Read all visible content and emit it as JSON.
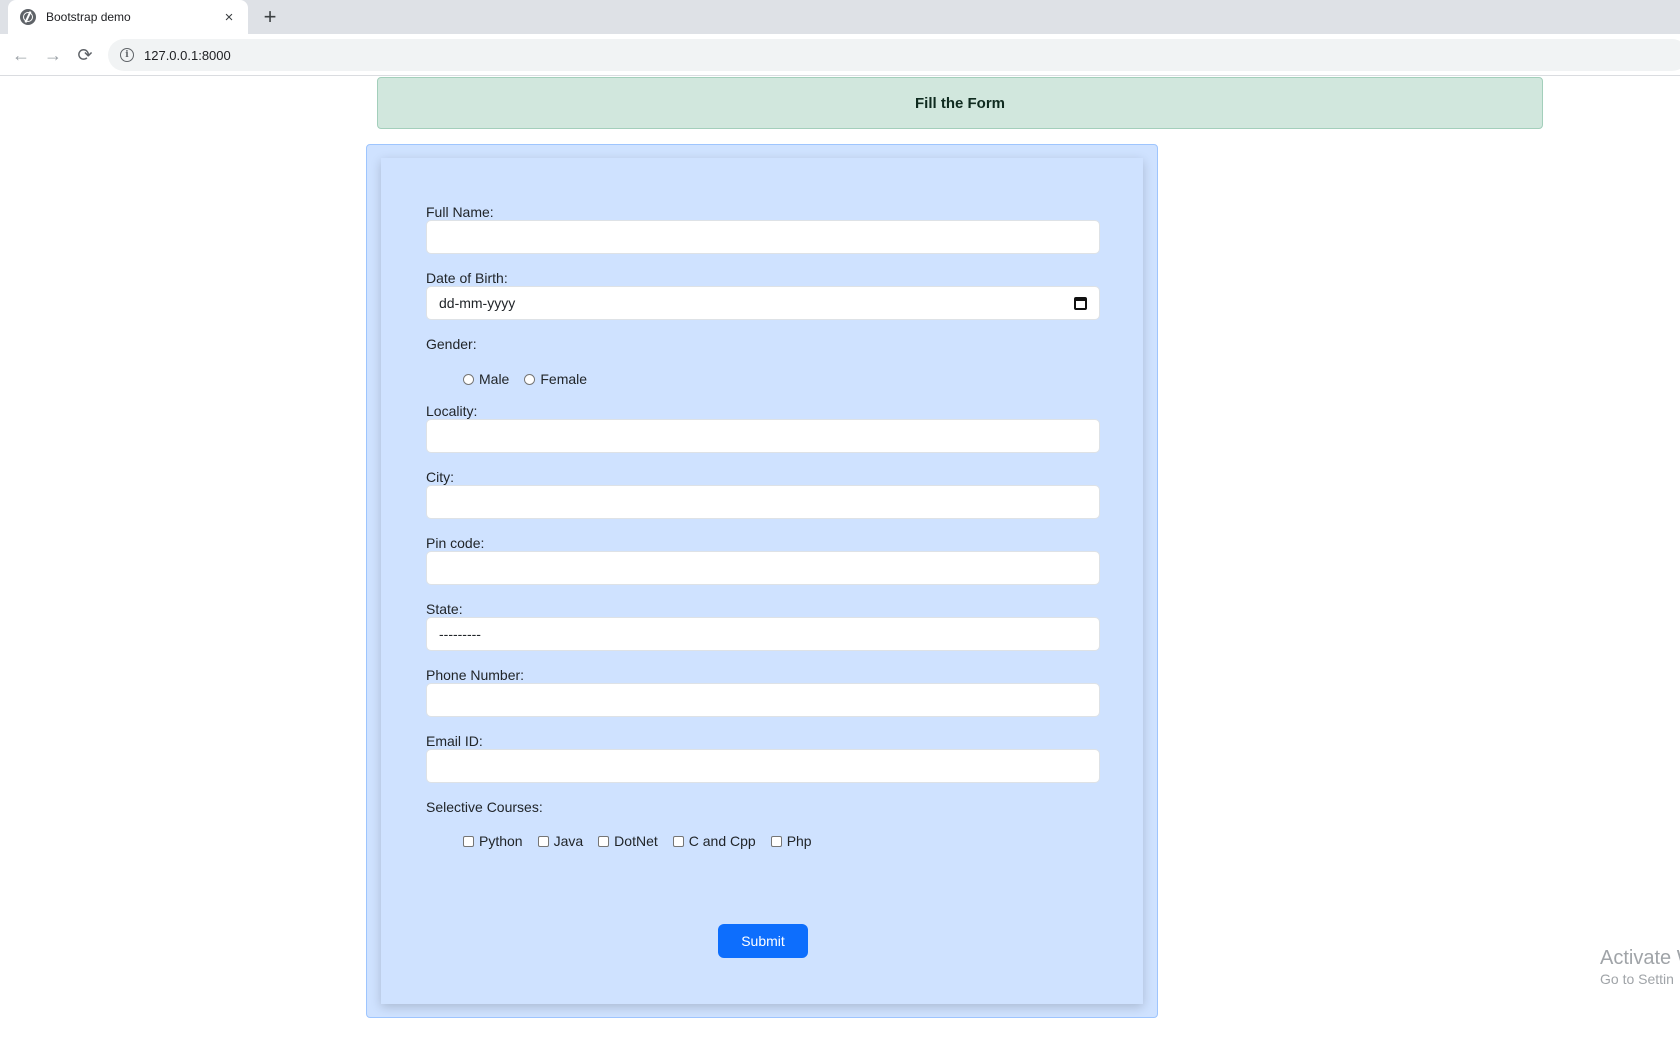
{
  "browser": {
    "tab_title": "Bootstrap demo",
    "tab_close": "×",
    "new_tab": "+",
    "back": "←",
    "forward": "→",
    "reload": "⟳",
    "info": "i",
    "url": "127.0.0.1:8000"
  },
  "alert": {
    "text": "Fill the Form"
  },
  "form": {
    "full_name_label": "Full Name:",
    "dob_label": "Date of Birth:",
    "dob_placeholder": "dd-mm-yyyy",
    "gender_label": "Gender:",
    "gender_options": [
      "Male",
      "Female"
    ],
    "locality_label": "Locality:",
    "city_label": "City:",
    "pincode_label": "Pin code:",
    "state_label": "State:",
    "state_selected": "---------",
    "phone_label": "Phone Number:",
    "email_label": "Email ID:",
    "courses_label": "Selective Courses:",
    "courses": [
      "Python",
      "Java",
      "DotNet",
      "C and Cpp",
      "Php"
    ],
    "submit_label": "Submit"
  },
  "watermark": {
    "title": "Activate W",
    "subtitle": "Go to Settin"
  },
  "colors": {
    "alert_bg": "#d1e7dd",
    "form_bg": "#cfe2ff",
    "submit_bg": "#0d6efd"
  }
}
